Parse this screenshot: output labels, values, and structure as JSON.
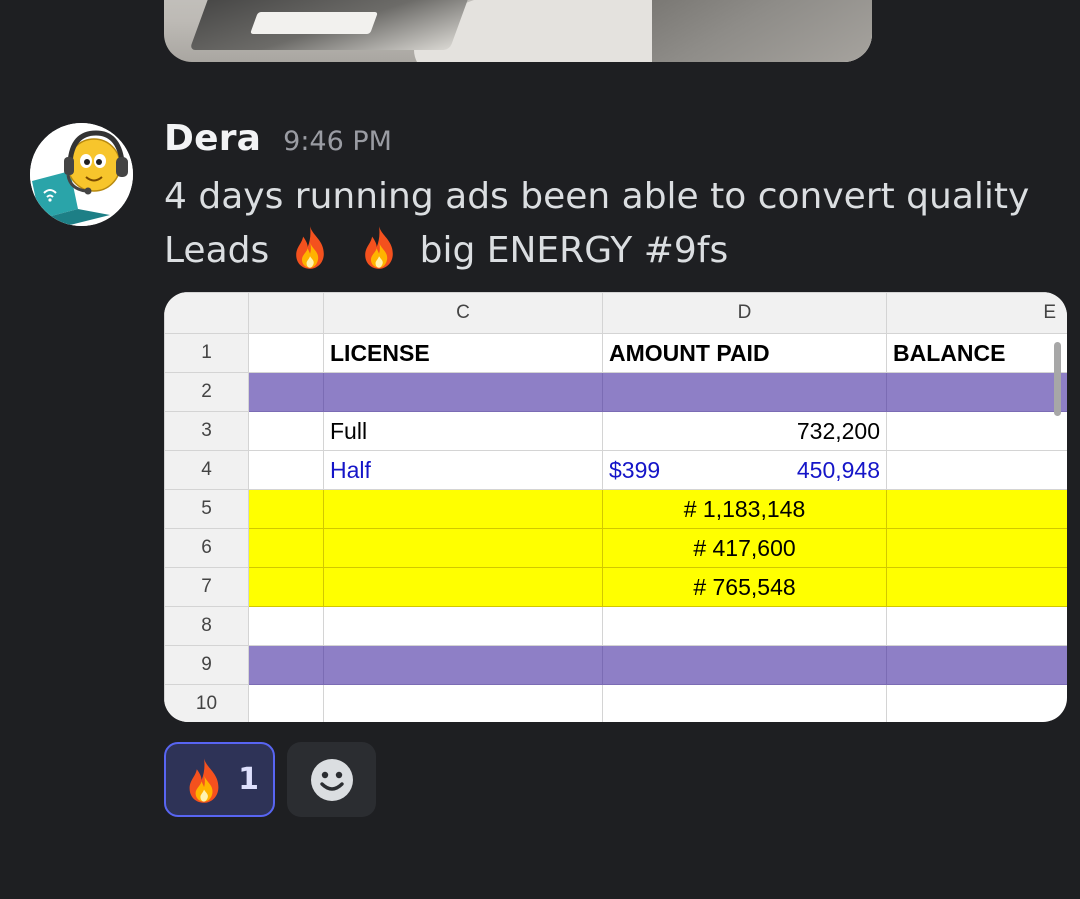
{
  "message": {
    "username": "Dera",
    "timestamp": "9:46 PM",
    "text_part1": "4 days running ads been able to convert quality Leads",
    "emoji": "fire-emoji",
    "text_part2": "big ENERGY #9fs"
  },
  "spreadsheet": {
    "columns": [
      "C",
      "D",
      "E"
    ],
    "rows": [
      {
        "num": "1",
        "c": "LICENSE",
        "d_left": "",
        "d": "AMOUNT PAID",
        "e": "BALANCE"
      },
      {
        "num": "2",
        "c": "",
        "d_left": "",
        "d": "",
        "e": ""
      },
      {
        "num": "3",
        "c": "Full",
        "d_left": "",
        "d": "732,200",
        "e": ""
      },
      {
        "num": "4",
        "c": "Half",
        "d_left": "$399",
        "d": "450,948",
        "e": ""
      },
      {
        "num": "5",
        "c": "",
        "d_left": "",
        "d": "# 1,183,148",
        "e": ""
      },
      {
        "num": "6",
        "c": "",
        "d_left": "",
        "d": "# 417,600",
        "e": ""
      },
      {
        "num": "7",
        "c": "",
        "d_left": "",
        "d": "# 765,548",
        "e": ""
      },
      {
        "num": "8",
        "c": "",
        "d_left": "",
        "d": "",
        "e": ""
      },
      {
        "num": "9",
        "c": "",
        "d_left": "",
        "d": "",
        "e": ""
      },
      {
        "num": "10",
        "c": "",
        "d_left": "",
        "d": "",
        "e": ""
      }
    ],
    "colors": {
      "purple_fill": "#8e7fc6",
      "yellow_fill": "#ffff00",
      "blue_text": "#1515c8"
    }
  },
  "reactions": [
    {
      "emoji": "fire-emoji",
      "count": "1",
      "selected": true
    }
  ],
  "add_reaction_icon": "smiley-icon",
  "colors": {
    "background": "#1e1f22",
    "username": "#f2f3f5",
    "text": "#dbdee1",
    "timestamp": "#9a9ca3",
    "reaction_border": "#5865f2"
  }
}
